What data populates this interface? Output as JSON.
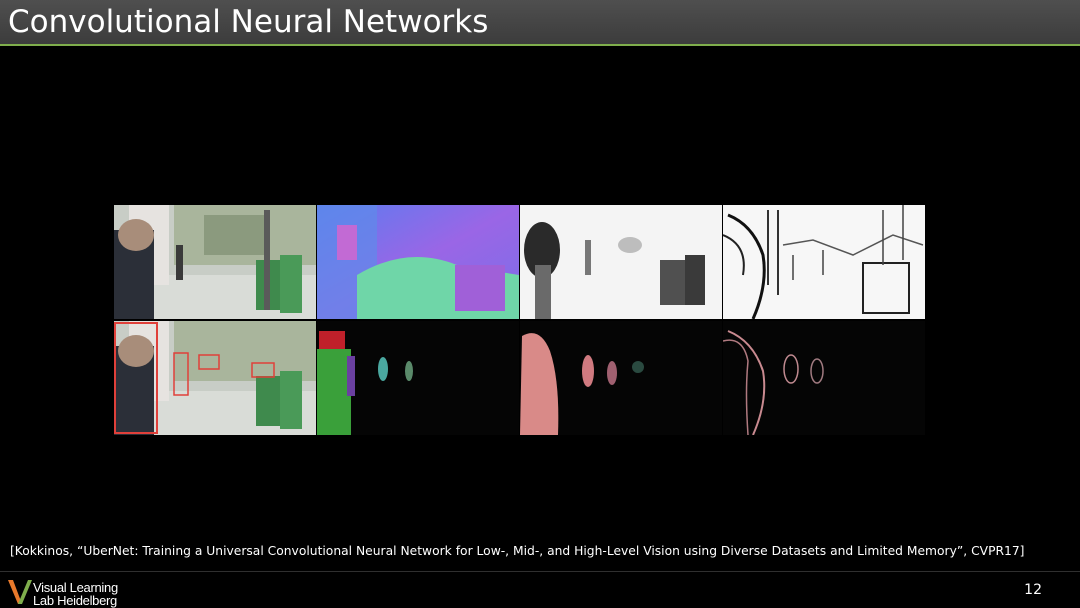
{
  "slide": {
    "title": "Convolutional Neural Networks",
    "citation": "[Kokkinos, “UberNet: Training a Universal Convolutional Neural Network for Low-, Mid-, and High-Level Vision using Diverse Datasets and Limited Memory”, CVPR17]",
    "page_number": "12"
  },
  "logo": {
    "line1": "Visual Learning",
    "line2": "Lab Heidelberg"
  },
  "colors": {
    "title_bar": "#444444",
    "accent_line": "#7fae4c",
    "logo_v_orange": "#e8792b",
    "logo_v_green": "#7fae4c"
  }
}
